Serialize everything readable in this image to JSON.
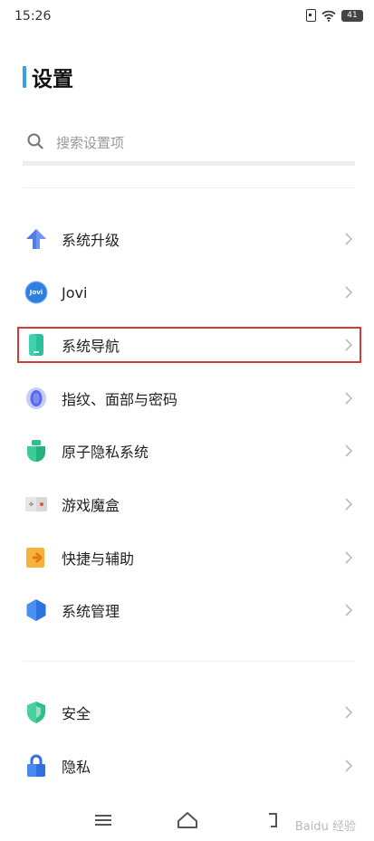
{
  "status_bar": {
    "time": "15:26",
    "battery": "41"
  },
  "page": {
    "title": "设置"
  },
  "search": {
    "placeholder": "搜索设置项"
  },
  "settings": {
    "items": [
      {
        "label": "系统升级",
        "icon": "arrow-up-icon"
      },
      {
        "label": "Jovi",
        "icon": "jovi-icon"
      },
      {
        "label": "系统导航",
        "icon": "phone-icon"
      },
      {
        "label": "指纹、面部与密码",
        "icon": "fingerprint-icon"
      },
      {
        "label": "原子隐私系统",
        "icon": "shield-badge-icon"
      },
      {
        "label": "游戏魔盒",
        "icon": "gamepad-icon"
      },
      {
        "label": "快捷与辅助",
        "icon": "shortcut-icon"
      },
      {
        "label": "系统管理",
        "icon": "hexagon-icon"
      },
      {
        "label": "安全",
        "icon": "shield-icon"
      },
      {
        "label": "隐私",
        "icon": "lock-icon"
      }
    ]
  },
  "jovi_badge": "Jovi",
  "watermark": "Baidu 经验",
  "colors": {
    "accent": "#3aa0e6",
    "highlight": "#d53a3a"
  }
}
